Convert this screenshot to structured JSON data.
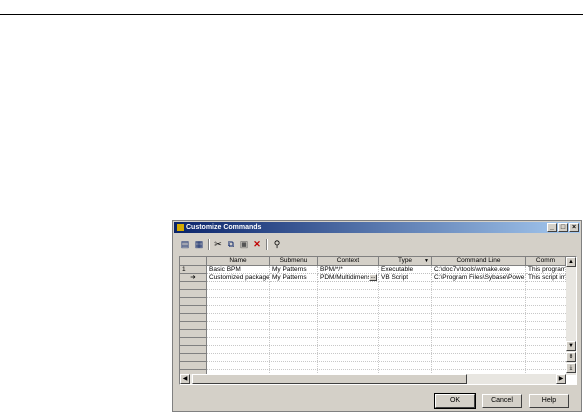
{
  "dialog": {
    "title": "Customize Commands",
    "title_buttons": [
      "_",
      "□",
      "×"
    ],
    "toolbar": [
      "add-row-icon",
      "properties-icon",
      "cut-icon",
      "copy-icon",
      "paste-icon",
      "delete-icon",
      "find-icon"
    ],
    "columns": [
      "Name",
      "Submenu",
      "Context",
      "Type",
      "Command Line",
      "Comm"
    ],
    "type_dropdown_glyph": "▼",
    "rows": [
      {
        "marker": "1",
        "name": "Basic BPM",
        "submenu": "My Patterns",
        "context": "BPM/*/*",
        "type": "Executable",
        "command_line": "C:\\doc7v\\tools\\wmake.exe",
        "comment": "This program c"
      },
      {
        "marker": "➔",
        "name": "Customized package",
        "submenu": "My Patterns",
        "context": "PDM/Multidimens",
        "type": "VB Script",
        "command_line": "C:\\Program Files\\Sybase\\Powe",
        "comment": "This script imp"
      }
    ],
    "context_button": "...",
    "buttons": {
      "ok": "OK",
      "cancel": "Cancel",
      "help": "Help"
    }
  }
}
